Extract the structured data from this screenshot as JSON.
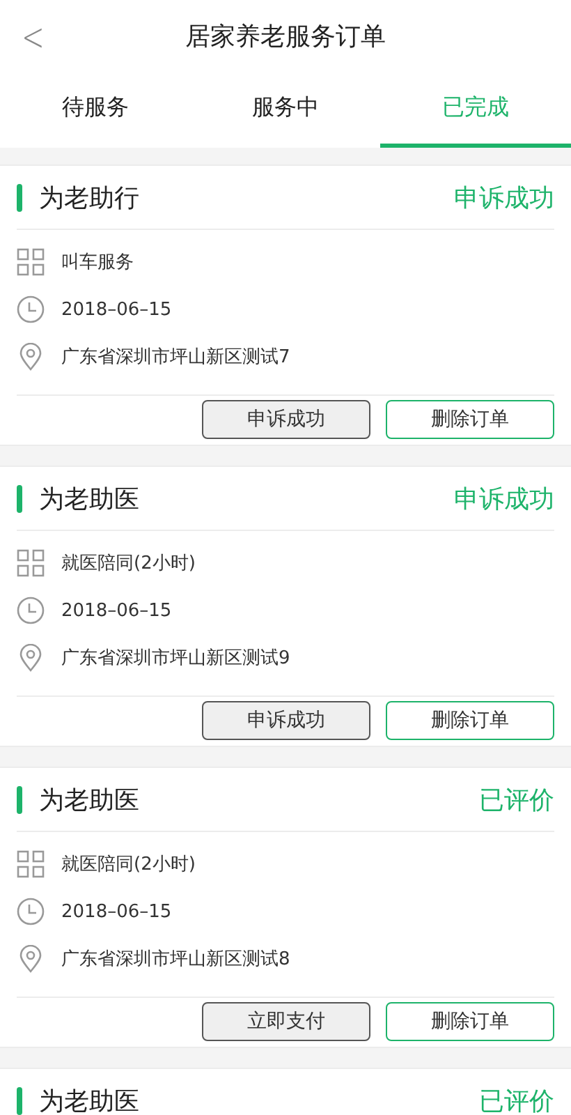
{
  "header": {
    "back": "<",
    "title": "居家养老服务订单"
  },
  "tabs": [
    {
      "label": "待服务",
      "selected": false
    },
    {
      "label": "服务中",
      "selected": false
    },
    {
      "label": "已完成",
      "selected": true
    }
  ],
  "orders": [
    {
      "title": "为老助行",
      "status": "申诉成功",
      "service": "叫车服务",
      "date": "2018–06–15",
      "address": "广东省深圳市坪山新区测试7",
      "buttons": [
        {
          "label": "申诉成功",
          "kind": "grey"
        },
        {
          "label": "删除订单",
          "kind": "green"
        }
      ]
    },
    {
      "title": "为老助医",
      "status": "申诉成功",
      "service": "就医陪同(2小时)",
      "date": "2018–06–15",
      "address": "广东省深圳市坪山新区测试9",
      "buttons": [
        {
          "label": "申诉成功",
          "kind": "grey"
        },
        {
          "label": "删除订单",
          "kind": "green"
        }
      ]
    },
    {
      "title": "为老助医",
      "status": "已评价",
      "service": "就医陪同(2小时)",
      "date": "2018–06–15",
      "address": "广东省深圳市坪山新区测试8",
      "buttons": [
        {
          "label": "立即支付",
          "kind": "grey"
        },
        {
          "label": "删除订单",
          "kind": "green"
        }
      ]
    },
    {
      "title": "为老助医",
      "status": "已评价"
    }
  ]
}
